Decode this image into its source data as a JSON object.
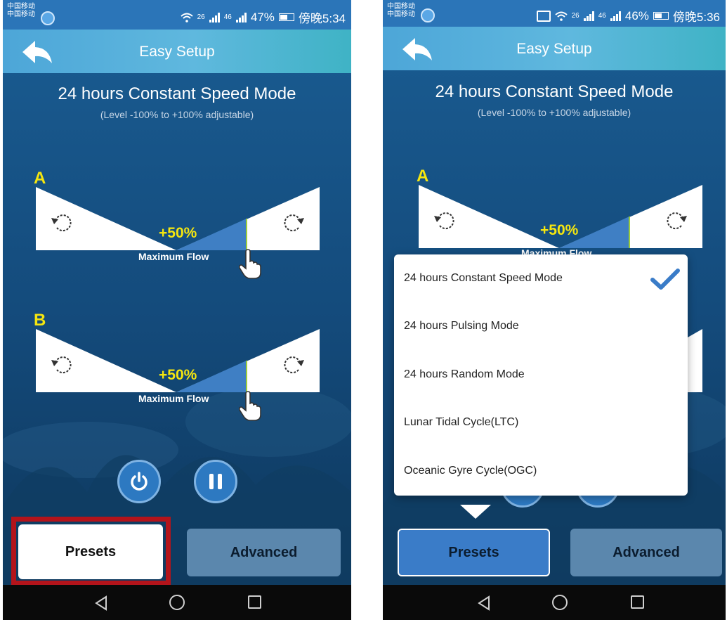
{
  "colors": {
    "accent": "#2d79c1",
    "header": "#4da6d8",
    "label_yellow": "#f5e60f",
    "highlight_red": "#b3141b"
  },
  "left": {
    "status": {
      "carrier_line1": "中国移动",
      "carrier_line2": "中国移动",
      "network": "26",
      "network2": "46",
      "battery": "47%",
      "time": "傍晚5:34"
    },
    "header": {
      "title": "Easy Setup"
    },
    "mode": {
      "title": "24 hours Constant Speed Mode",
      "subtitle": "(Level -100% to +100% adjustable)"
    },
    "pump_a": {
      "label": "A",
      "percent": "+50%",
      "flow_label": "Maximum Flow",
      "level": 0.5
    },
    "pump_b": {
      "label": "B",
      "percent": "+50%",
      "flow_label": "Maximum Flow",
      "level": 0.5
    },
    "buttons": {
      "presets": "Presets",
      "advanced": "Advanced"
    }
  },
  "right": {
    "status": {
      "carrier_line1": "中国移动",
      "carrier_line2": "中国移动",
      "network": "26",
      "network2": "46",
      "battery": "46%",
      "time": "傍晚5:36"
    },
    "header": {
      "title": "Easy Setup"
    },
    "mode": {
      "title": "24 hours Constant Speed Mode",
      "subtitle": "(Level -100% to +100% adjustable)"
    },
    "pump_a": {
      "label": "A",
      "percent": "+50%",
      "flow_label": "Maximum Flow",
      "level": 0.5
    },
    "dropdown": {
      "items": [
        {
          "label": "24 hours Constant Speed Mode",
          "selected": true
        },
        {
          "label": "24 hours Pulsing Mode",
          "selected": false
        },
        {
          "label": "24 hours Random Mode",
          "selected": false
        },
        {
          "label": "Lunar Tidal Cycle(LTC)",
          "selected": false
        },
        {
          "label": "Oceanic Gyre Cycle(OGC)",
          "selected": false
        }
      ]
    },
    "buttons": {
      "presets": "Presets",
      "advanced": "Advanced"
    }
  }
}
